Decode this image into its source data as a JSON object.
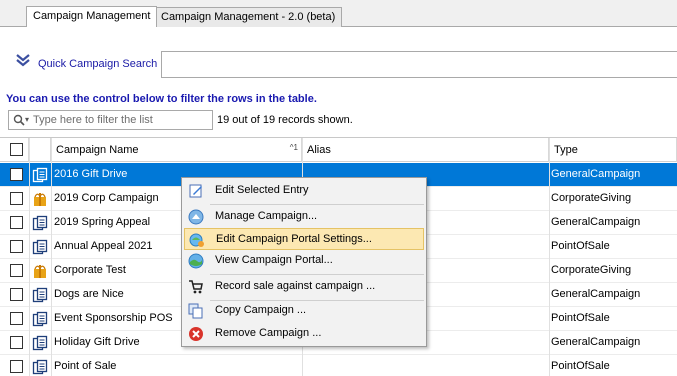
{
  "tabs": [
    {
      "label": "Campaign Management",
      "active": true
    },
    {
      "label": "Campaign Management - 2.0 (beta)",
      "active": false
    }
  ],
  "quick_search": {
    "label": "Quick Campaign Search :",
    "icon": "double-chevron-down-icon",
    "value": ""
  },
  "hint": "You can use the control below to filter the rows in the table.",
  "filter": {
    "placeholder": "Type here to filter the list",
    "value": "",
    "icon": "magnifier-icon"
  },
  "records_text": "19 out of 19 records shown.",
  "grid": {
    "columns": [
      "Campaign Name",
      "Alias",
      "Type"
    ],
    "sort_indicator": "^1",
    "rows": [
      {
        "name": "2016 Gift Drive",
        "alias": "",
        "type": "GeneralCampaign",
        "icon": "document-icon",
        "selected": true
      },
      {
        "name": "2019 Corp Campaign",
        "alias": "",
        "type": "CorporateGiving",
        "icon": "gift-icon",
        "selected": false
      },
      {
        "name": "2019 Spring Appeal",
        "alias": "",
        "type": "GeneralCampaign",
        "icon": "document-icon",
        "selected": false
      },
      {
        "name": "Annual Appeal 2021",
        "alias": "",
        "type": "PointOfSale",
        "icon": "document-icon",
        "selected": false
      },
      {
        "name": "Corporate Test",
        "alias": "",
        "type": "CorporateGiving",
        "icon": "gift-icon",
        "selected": false
      },
      {
        "name": "Dogs are Nice",
        "alias": "",
        "type": "GeneralCampaign",
        "icon": "document-icon",
        "selected": false
      },
      {
        "name": "Event Sponsorship POS",
        "alias": "",
        "type": "PointOfSale",
        "icon": "document-icon",
        "selected": false
      },
      {
        "name": "Holiday Gift Drive",
        "alias": "",
        "type": "GeneralCampaign",
        "icon": "document-icon",
        "selected": false
      },
      {
        "name": "Point of Sale",
        "alias": "",
        "type": "PointOfSale",
        "icon": "document-icon",
        "selected": false
      }
    ]
  },
  "context_menu": {
    "items": [
      {
        "label": "Edit Selected Entry",
        "icon": "edit-entry-icon",
        "highlighted": false
      },
      {
        "label": "Manage Campaign...",
        "icon": "manage-campaign-icon",
        "highlighted": false
      },
      {
        "label": "Edit Campaign Portal Settings...",
        "icon": "portal-settings-icon",
        "highlighted": true
      },
      {
        "label": "View Campaign Portal...",
        "icon": "view-portal-icon",
        "highlighted": false
      },
      {
        "label": "Record sale against campaign ...",
        "icon": "cart-icon",
        "highlighted": false
      },
      {
        "label": "Copy Campaign ...",
        "icon": "copy-icon",
        "highlighted": false
      },
      {
        "label": "Remove Campaign ...",
        "icon": "remove-icon",
        "highlighted": false
      }
    ]
  },
  "colors": {
    "selection": "#0078d7",
    "menu_highlight": "#fce8b2",
    "link_blue": "#1a1aa6"
  }
}
